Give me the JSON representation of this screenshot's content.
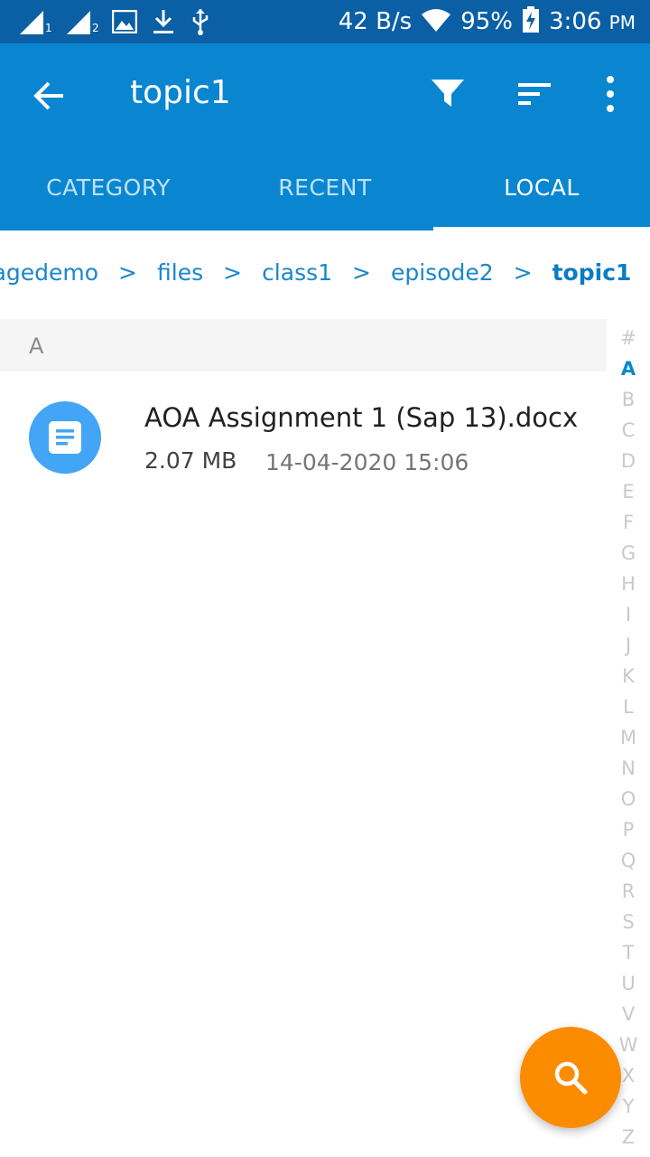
{
  "status_bar": {
    "sim1_label": "1",
    "sim2_label": "2",
    "network_speed": "42 B/s",
    "battery": "95%",
    "time": "3:06",
    "ampm": "PM"
  },
  "toolbar": {
    "title": "topic1"
  },
  "tabs": [
    {
      "label": "CATEGORY"
    },
    {
      "label": "RECENT"
    },
    {
      "label": "LOCAL"
    }
  ],
  "breadcrumb": {
    "items": [
      "oragedemo",
      "files",
      "class1",
      "episode2",
      "topic1"
    ],
    "separator": ">"
  },
  "section": {
    "header": "A"
  },
  "files": [
    {
      "name": "AOA Assignment 1 (Sap 13).docx",
      "size": "2.07 MB",
      "date": "14-04-2020 15:06"
    }
  ],
  "alphabet_index": {
    "letters": [
      "#",
      "A",
      "B",
      "C",
      "D",
      "E",
      "F",
      "G",
      "H",
      "I",
      "J",
      "K",
      "L",
      "M",
      "N",
      "O",
      "P",
      "Q",
      "R",
      "S",
      "T",
      "U",
      "V",
      "W",
      "X",
      "Y",
      "Z"
    ],
    "active": "A"
  },
  "colors": {
    "status_bar": "#0b5fa5",
    "app_bar": "#0a86d1",
    "fab": "#fb8c00",
    "file_icon": "#42a5f5"
  },
  "icons": {
    "status_left": [
      "signal-sim1-icon",
      "signal-sim2-icon",
      "image-icon",
      "download-icon",
      "usb-icon"
    ],
    "status_right": [
      "wifi-icon",
      "battery-charging-icon"
    ],
    "toolbar": [
      "back-arrow-icon",
      "filter-icon",
      "sort-icon",
      "more-vert-icon"
    ],
    "file": "document-icon",
    "fab": "search-icon"
  }
}
